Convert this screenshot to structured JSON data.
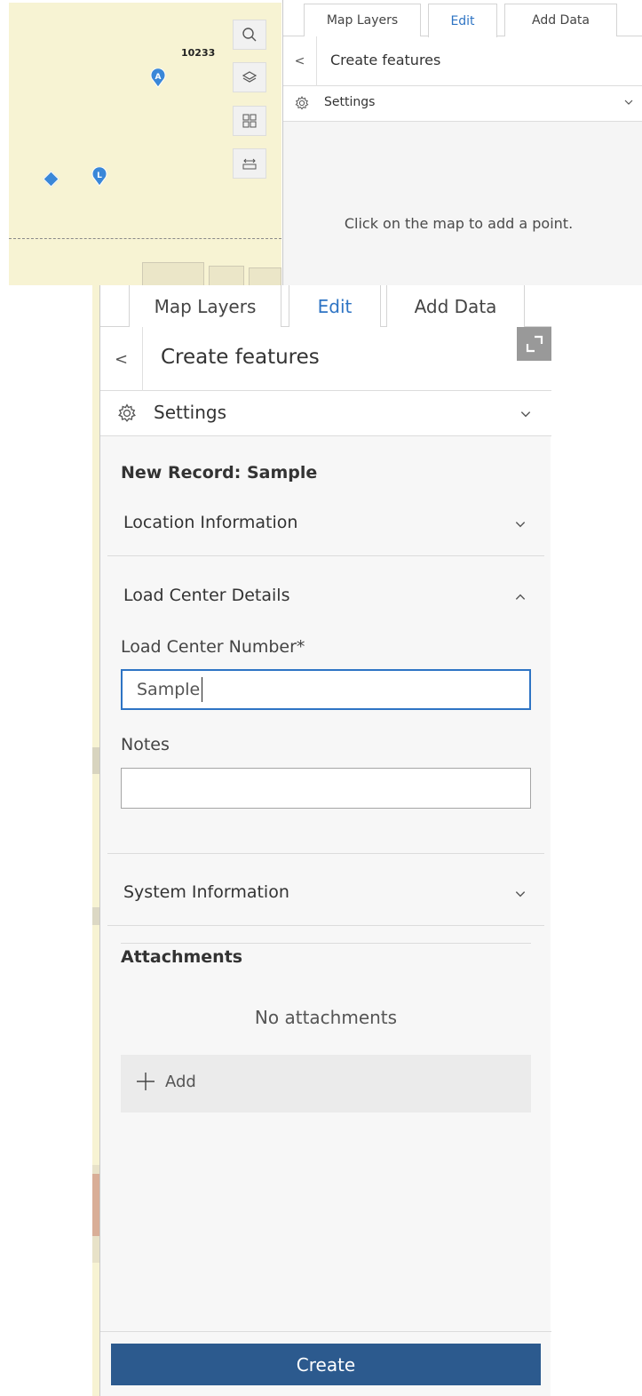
{
  "top": {
    "map": {
      "label": "10233",
      "pins": [
        "A",
        "L"
      ]
    },
    "tabs": [
      "Map Layers",
      "Edit",
      "Add Data"
    ],
    "active_tab": "Edit",
    "back_label": "<",
    "title": "Create features",
    "settings_label": "Settings",
    "hint": "Click on the map to add a point."
  },
  "bottom": {
    "tabs": [
      "Map Layers",
      "Edit",
      "Add Data"
    ],
    "active_tab": "Edit",
    "back_label": "<",
    "title": "Create features",
    "settings_label": "Settings",
    "form_title": "New Record: Sample",
    "groups": {
      "location": "Location Information",
      "load_center": "Load Center Details",
      "system": "System Information"
    },
    "fields": {
      "load_center_number": {
        "label": "Load Center Number*",
        "value": "Sample"
      },
      "notes": {
        "label": "Notes",
        "value": ""
      }
    },
    "attachments": {
      "title": "Attachments",
      "empty": "No attachments",
      "add_label": "Add"
    },
    "create_label": "Create"
  },
  "colors": {
    "accent": "#2e74c4",
    "create_button": "#2c5a8e",
    "map_background": "#f7f3d3",
    "pin": "#3a87d8"
  }
}
